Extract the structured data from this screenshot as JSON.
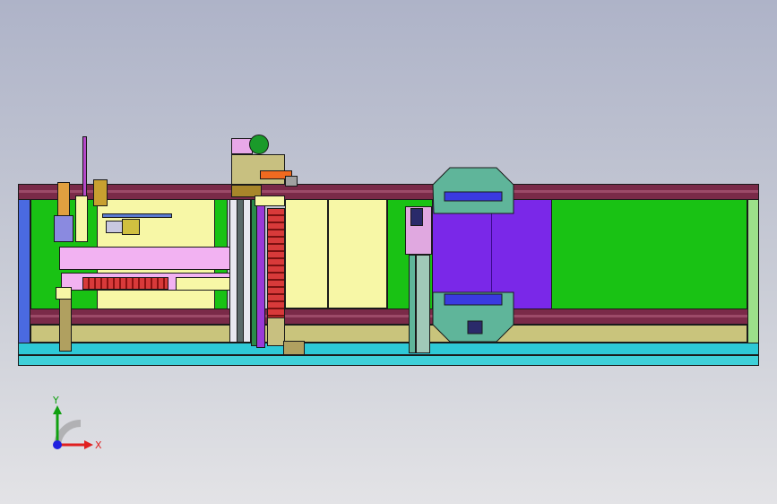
{
  "viewport": {
    "background_top": "#aeb3c8",
    "background_bottom": "#e3e3e6",
    "model_colors": {
      "frame_rail": "#7a2a48",
      "base_plate": "#2ec9d6",
      "green_panel": "#19c214",
      "yellow_panel": "#f7f7a6",
      "purple_panel": "#7a28e8",
      "pink_beam": "#f2b2f2",
      "teal_plate": "#5fb59a",
      "khaki_strip": "#c9c47c"
    }
  },
  "triad": {
    "x_label": "X",
    "y_label": "Y",
    "x_color": "#e02020",
    "y_color": "#10a010",
    "z_color": "#2020e0"
  }
}
